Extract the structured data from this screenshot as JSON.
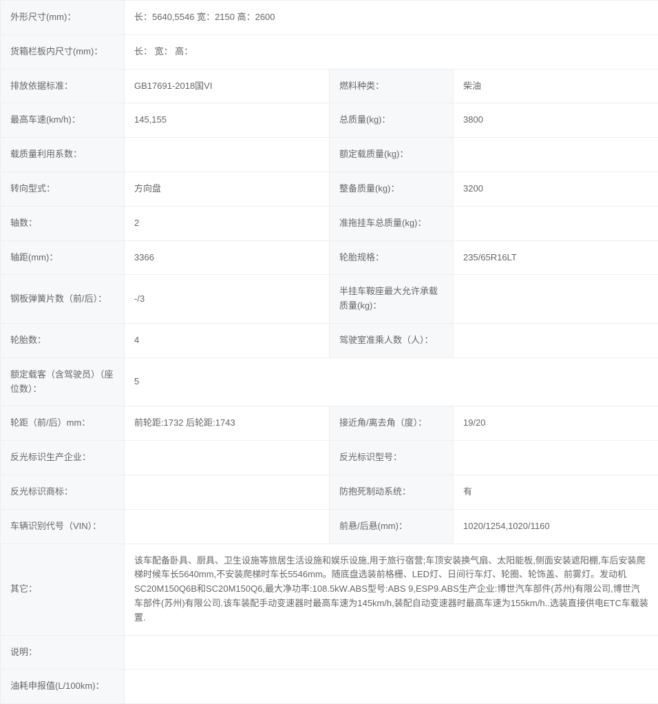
{
  "rows": {
    "dim_label": "外形尺寸(mm)：",
    "dim_value": "长：5640,5546 宽：2150 高：2600",
    "cargo_label": "货箱栏板内尺寸(mm)：",
    "cargo_value": "长： 宽： 高：",
    "emission_label": "排放依据标准：",
    "emission_value": "GB17691-2018国VI",
    "fuel_label": "燃料种类：",
    "fuel_value": "柴油",
    "maxspeed_label": "最高车速(km/h)：",
    "maxspeed_value": "145,155",
    "gross_label": "总质量(kg)：",
    "gross_value": "3800",
    "loadutil_label": "载质量利用系数：",
    "loadutil_value": "",
    "rated_label": "额定载质量(kg)：",
    "rated_value": "",
    "steer_label": "转向型式：",
    "steer_value": "方向盘",
    "curb_label": "整备质量(kg)：",
    "curb_value": "3200",
    "axles_label": "轴数：",
    "axles_value": "2",
    "trailer_label": "准拖挂车总质量(kg)：",
    "trailer_value": "",
    "wheelbase_label": "轴距(mm)：",
    "wheelbase_value": "3366",
    "tirespec_label": "轮胎规格：",
    "tirespec_value": "235/65R16LT",
    "spring_label": "钢板弹簧片数（前/后）：",
    "spring_value": "-/3",
    "semi_label": "半挂车鞍座最大允许承载质量(kg)：",
    "semi_value": "",
    "tirecount_label": "轮胎数：",
    "tirecount_value": "4",
    "cab_label": "驾驶室准乘人数（人）：",
    "cab_value": "",
    "passengers_label": "额定载客（含驾驶员）（座位数）：",
    "passengers_value": "5",
    "track_label": "轮距（前/后）mm：",
    "track_value": "前轮距:1732 后轮距:1743",
    "angle_label": "接近角/离去角（度）：",
    "angle_value": "19/20",
    "reflmfr_label": "反光标识生产企业：",
    "reflmfr_value": "",
    "reflmodel_label": "反光标识型号：",
    "reflmodel_value": "",
    "refltm_label": "反光标识商标：",
    "refltm_value": "",
    "abs_label": "防抱死制动系统：",
    "abs_value": "有",
    "vin_label": "车辆识别代号（VIN）：",
    "vin_value": "",
    "overhang_label": "前悬/后悬(mm)：",
    "overhang_value": "1020/1254,1020/1160",
    "other_label": "其它：",
    "other_value": "该车配备卧具、厨具、卫生设施等旅居生活设施和娱乐设施,用于旅行宿营;车顶安装换气扇、太阳能板,侧面安装遮阳棚,车后安装爬梯时候车长5640mm,不安装爬梯时车长5546mm。随底盘选装前格栅、LED灯、日间行车灯、轮圈、轮饰盖、前雾灯。发动机SC20M150Q6B和SC20M150Q6,最大净功率:108.5kW.ABS型号:ABS 9,ESP9.ABS生产企业:博世汽车部件(苏州)有限公司,博世汽车部件(苏州)有限公司.该车装配手动变速器时最高车速为145km/h,装配自动变速器时最高车速为155km/h..选装直接供电ETC车载装置.",
    "note_label": "说明：",
    "note_value": "",
    "fuelcons_label": "油耗申报值(L/100km)：",
    "fuelcons_value": ""
  }
}
